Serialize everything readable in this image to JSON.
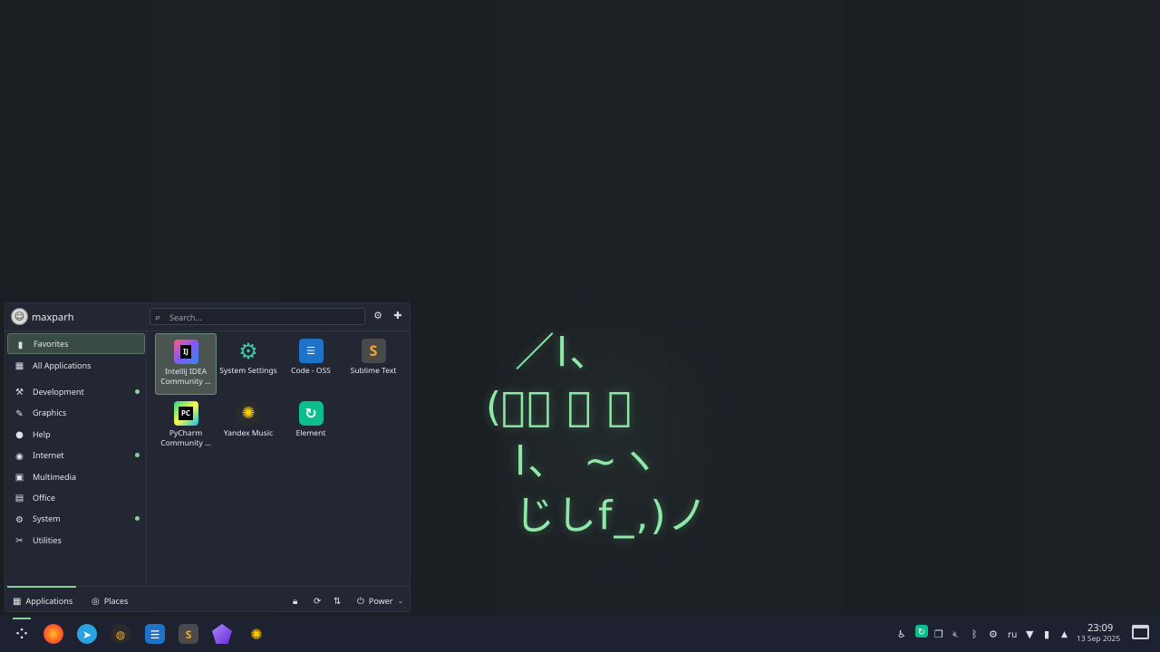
{
  "wallpaper": {
    "art_lines": [
      "  ／l、",
      "(ﾟ､ 。 ７",
      "  l、 ~ヽ",
      "  じしf_,)ノ"
    ],
    "accent": "#8ee8a6"
  },
  "launcher": {
    "username": "maxparh",
    "search": {
      "placeholder": "Search..."
    },
    "header_icons": [
      "settings-icon",
      "pin-icon"
    ],
    "sidebar": {
      "items": [
        {
          "label": "Favorites",
          "icon": "bookmark-icon",
          "active": true,
          "dot": false
        },
        {
          "label": "All Applications",
          "icon": "grid-icon",
          "active": false,
          "dot": false
        },
        {
          "label": "Development",
          "icon": "development-icon",
          "active": false,
          "dot": true
        },
        {
          "label": "Graphics",
          "icon": "graphics-icon",
          "active": false,
          "dot": false
        },
        {
          "label": "Help",
          "icon": "help-icon",
          "active": false,
          "dot": false
        },
        {
          "label": "Internet",
          "icon": "globe-icon",
          "active": false,
          "dot": true
        },
        {
          "label": "Multimedia",
          "icon": "multimedia-icon",
          "active": false,
          "dot": false
        },
        {
          "label": "Office",
          "icon": "office-icon",
          "active": false,
          "dot": false
        },
        {
          "label": "System",
          "icon": "gear-icon",
          "active": false,
          "dot": true
        },
        {
          "label": "Utilities",
          "icon": "utilities-icon",
          "active": false,
          "dot": false
        }
      ]
    },
    "apps": [
      {
        "label": "Intellij IDEA Community ...",
        "icon": "intellij-icon"
      },
      {
        "label": "System Settings",
        "icon": "system-settings-icon"
      },
      {
        "label": "Code - OSS",
        "icon": "code-oss-icon"
      },
      {
        "label": "Sublime Text",
        "icon": "sublime-icon"
      },
      {
        "label": "PyCharm Community ...",
        "icon": "pycharm-icon"
      },
      {
        "label": "Yandex Music",
        "icon": "yandex-music-icon"
      },
      {
        "label": "Element",
        "icon": "element-icon"
      }
    ],
    "footer": {
      "tab_applications": "Applications",
      "tab_places": "Places",
      "power_label": "Power"
    }
  },
  "taskbar": {
    "apps": [
      "app-launcher-icon",
      "firefox-icon",
      "telegram-icon",
      "browser-icon",
      "code-oss-icon",
      "sublime-icon",
      "obsidian-icon",
      "yandex-music-icon"
    ],
    "tray": {
      "keyboard_layout": "ru",
      "time": "23:09",
      "date": "13 Sep 2025"
    }
  }
}
